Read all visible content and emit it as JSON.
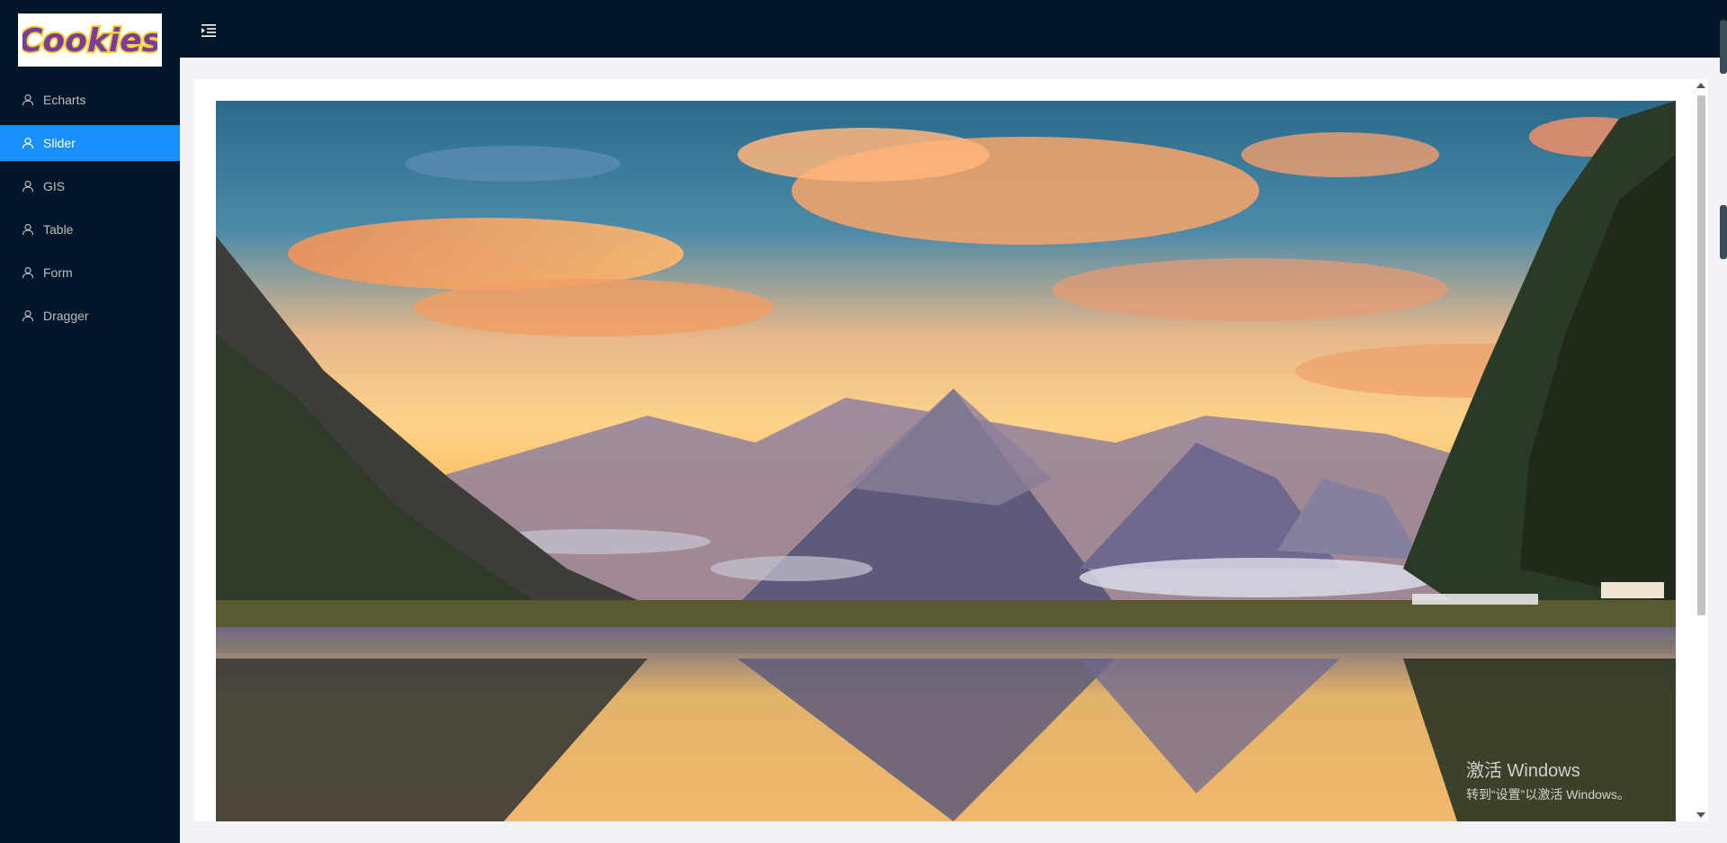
{
  "logo": {
    "text": "Cookies"
  },
  "sidebar": {
    "items": [
      {
        "label": "Echarts",
        "icon": "user-icon",
        "active": false
      },
      {
        "label": "Slider",
        "icon": "user-icon",
        "active": true
      },
      {
        "label": "GIS",
        "icon": "user-icon",
        "active": false
      },
      {
        "label": "Table",
        "icon": "user-icon",
        "active": false
      },
      {
        "label": "Form",
        "icon": "user-icon",
        "active": false
      },
      {
        "label": "Dragger",
        "icon": "user-icon",
        "active": false
      }
    ]
  },
  "header": {
    "fold_icon": "menu-fold-icon"
  },
  "watermark": {
    "title": "激活 Windows",
    "subtitle": "转到“设置”以激活 Windows。"
  },
  "colors": {
    "sidebar_bg": "#001529",
    "active_item": "#1890ff",
    "content_bg": "#f0f2f5"
  }
}
